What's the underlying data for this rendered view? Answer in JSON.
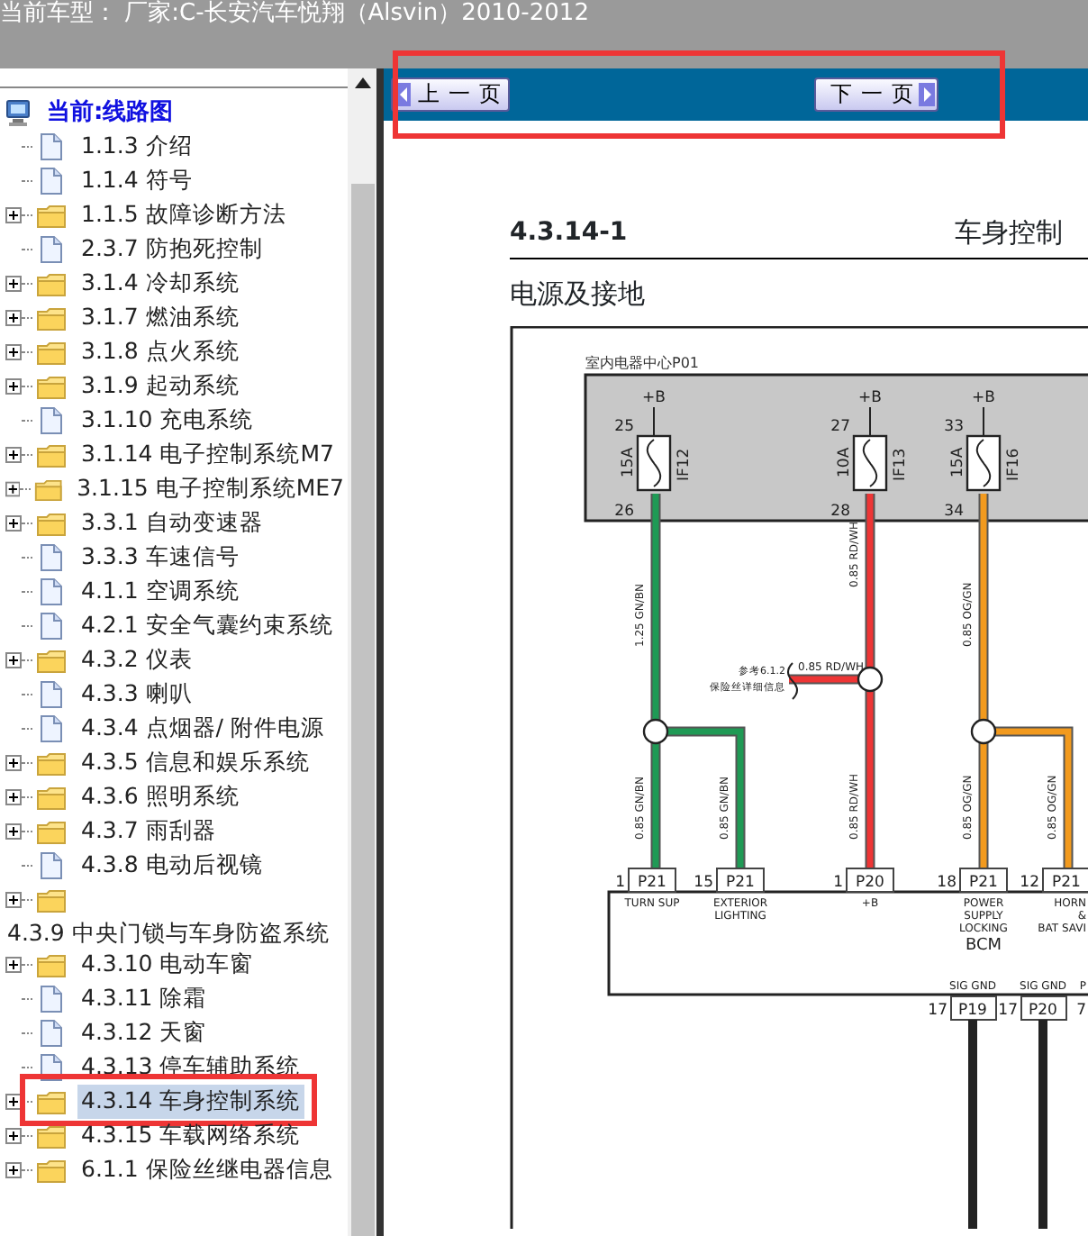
{
  "title": "当前车型： 厂家:C-长安汽车悦翔（Alsvin）2010-2012",
  "nav": {
    "highlighted": true,
    "buttons": [
      {
        "label": "上一页",
        "kind": "prev"
      },
      {
        "label": "下一页",
        "kind": "next"
      }
    ]
  },
  "tree": {
    "root": "当前:线路图",
    "items": [
      {
        "kind": "page",
        "label": "1.1.3 介绍",
        "selected": false,
        "highlighted": false
      },
      {
        "kind": "page",
        "label": "1.1.4 符号",
        "selected": false,
        "highlighted": false
      },
      {
        "kind": "folder",
        "label": "1.1.5 故障诊断方法",
        "selected": false,
        "highlighted": false
      },
      {
        "kind": "page",
        "label": "2.3.7 防抱死控制",
        "selected": false,
        "highlighted": false
      },
      {
        "kind": "folder",
        "label": "3.1.4 冷却系统",
        "selected": false,
        "highlighted": false
      },
      {
        "kind": "folder",
        "label": "3.1.7 燃油系统",
        "selected": false,
        "highlighted": false
      },
      {
        "kind": "folder",
        "label": "3.1.8 点火系统",
        "selected": false,
        "highlighted": false
      },
      {
        "kind": "folder",
        "label": "3.1.9 起动系统",
        "selected": false,
        "highlighted": false
      },
      {
        "kind": "page",
        "label": "3.1.10 充电系统",
        "selected": false,
        "highlighted": false
      },
      {
        "kind": "folder",
        "label": "3.1.14 电子控制系统M7",
        "selected": false,
        "highlighted": false
      },
      {
        "kind": "folder",
        "label": "3.1.15 电子控制系统ME7",
        "selected": false,
        "highlighted": false
      },
      {
        "kind": "folder",
        "label": "3.3.1 自动变速器",
        "selected": false,
        "highlighted": false
      },
      {
        "kind": "page",
        "label": "3.3.3 车速信号",
        "selected": false,
        "highlighted": false
      },
      {
        "kind": "page",
        "label": "4.1.1 空调系统",
        "selected": false,
        "highlighted": false
      },
      {
        "kind": "page",
        "label": "4.2.1 安全气囊约束系统",
        "selected": false,
        "highlighted": false
      },
      {
        "kind": "folder",
        "label": "4.3.2 仪表",
        "selected": false,
        "highlighted": false
      },
      {
        "kind": "page",
        "label": "4.3.3 喇叭",
        "selected": false,
        "highlighted": false
      },
      {
        "kind": "page",
        "label": "4.3.4 点烟器/ 附件电源",
        "selected": false,
        "highlighted": false
      },
      {
        "kind": "folder",
        "label": "4.3.5 信息和娱乐系统",
        "selected": false,
        "highlighted": false
      },
      {
        "kind": "folder",
        "label": "4.3.6 照明系统",
        "selected": false,
        "highlighted": false
      },
      {
        "kind": "folder",
        "label": "4.3.7 雨刮器",
        "selected": false,
        "highlighted": false
      },
      {
        "kind": "page",
        "label": "4.3.8 电动后视镜",
        "selected": false,
        "highlighted": false
      },
      {
        "kind": "folder-wrapped",
        "label": "4.3.9 中央门锁与车身防盗系统",
        "selected": false,
        "highlighted": false
      },
      {
        "kind": "folder",
        "label": "4.3.10 电动车窗",
        "selected": false,
        "highlighted": false
      },
      {
        "kind": "page",
        "label": "4.3.11 除霜",
        "selected": false,
        "highlighted": false
      },
      {
        "kind": "page",
        "label": "4.3.12 天窗",
        "selected": false,
        "highlighted": false
      },
      {
        "kind": "page",
        "label": "4.3.13 停车辅助系统",
        "selected": false,
        "highlighted": false
      },
      {
        "kind": "folder",
        "label": "4.3.14 车身控制系统",
        "selected": true,
        "highlighted": true
      },
      {
        "kind": "folder",
        "label": "4.3.15 车载网络系统",
        "selected": false,
        "highlighted": false
      },
      {
        "kind": "folder",
        "label": "6.1.1 保险丝继电器信息",
        "selected": false,
        "highlighted": false
      }
    ]
  },
  "page": {
    "section": "4.3.14-1",
    "title": "车身控制",
    "subtitle": "电源及接地",
    "diagram": {
      "module_label": "室内电器中心P01",
      "fuses": [
        {
          "supply": "+B",
          "pin_in": "25",
          "pin_out": "26",
          "rating": "15A",
          "name": "IF12"
        },
        {
          "supply": "+B",
          "pin_in": "27",
          "pin_out": "28",
          "rating": "10A",
          "name": "IF13"
        },
        {
          "supply": "+B",
          "pin_in": "33",
          "pin_out": "34",
          "rating": "15A",
          "name": "IF16"
        }
      ],
      "circuits": [
        {
          "color": "#1f9a55",
          "label": "1.25 GN/BN",
          "branches": [
            "0.85 GN/BN",
            "0.85 GN/BN"
          ]
        },
        {
          "color": "#ee3535",
          "label": "0.85 RD/WH",
          "branches": [
            "0.85 RD/WH"
          ],
          "splice_label": "0.85 RD/WH",
          "note": [
            "参考6.1.2",
            "保险丝详细信息"
          ]
        },
        {
          "color": "#f29a1e",
          "label": "0.85 OG/GN",
          "branches": [
            "0.85 OG/GN",
            "0.85 OG/GN"
          ]
        }
      ],
      "pins": [
        {
          "number": "1",
          "connector": "P21",
          "function": [
            "TURN SUP"
          ]
        },
        {
          "number": "15",
          "connector": "P21",
          "function": [
            "EXTERIOR",
            "LIGHTING"
          ]
        },
        {
          "number": "1",
          "connector": "P20",
          "function": [
            "+B"
          ]
        },
        {
          "number": "18",
          "connector": "P21",
          "function": [
            "POWER",
            "SUPPLY",
            "LOCKING"
          ]
        },
        {
          "number": "12",
          "connector": "P21",
          "function": [
            "HORN",
            "&",
            "BAT SAVI"
          ]
        }
      ],
      "module": "BCM",
      "ground_pins": [
        {
          "function": "SIG GND",
          "number": "17",
          "connector": "P19"
        },
        {
          "function": "SIG GND",
          "number": "17",
          "connector": "P20"
        },
        {
          "function": "P",
          "number": "7"
        }
      ]
    }
  }
}
